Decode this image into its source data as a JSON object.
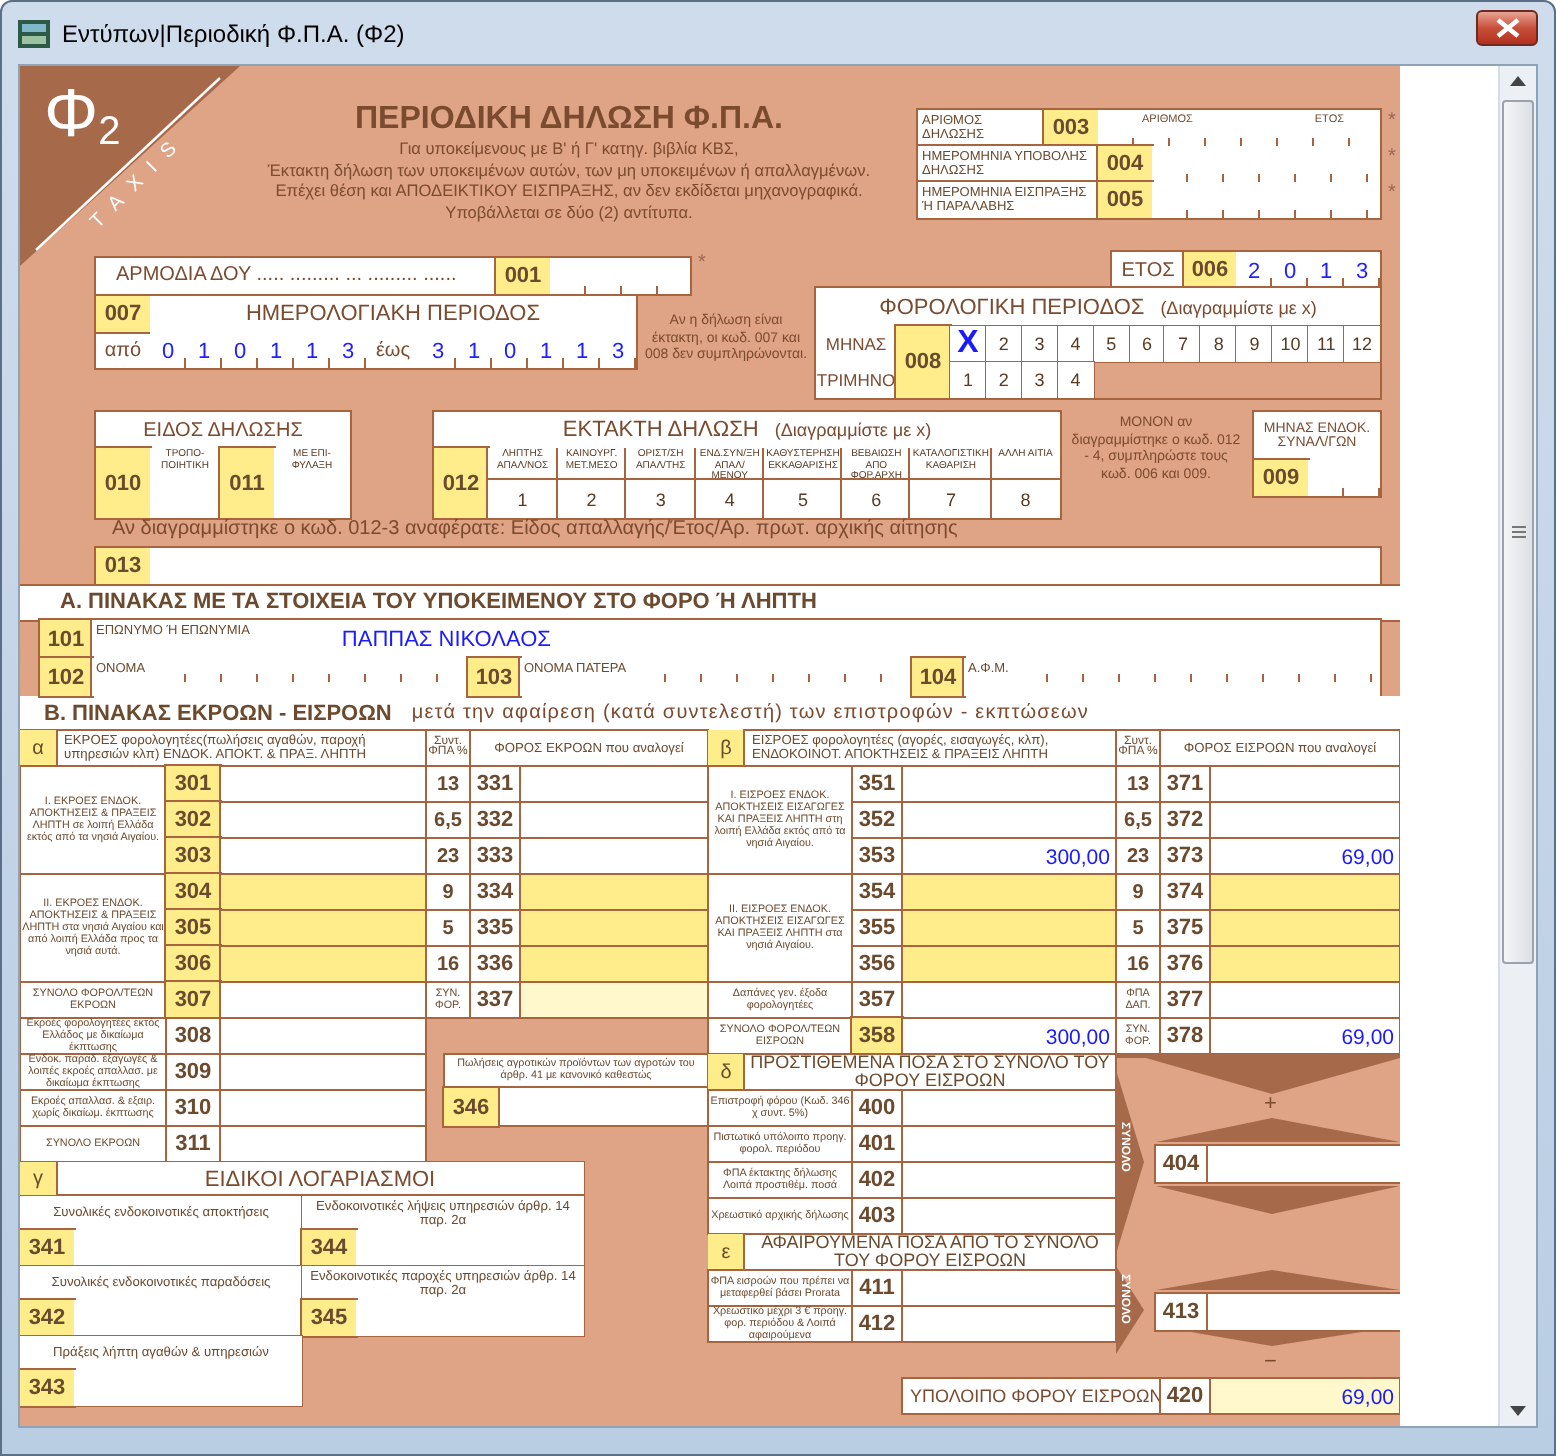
{
  "window": {
    "title": "Εντύπων|Περιοδική Φ.Π.Α. (Φ2)"
  },
  "form": {
    "logo": {
      "symbol": "Φ$_{2}$",
      "brand": "TAXIS"
    },
    "heading": {
      "title": "ΠΕΡΙΟΔΙΚΗ ΔΗΛΩΣΗ Φ.Π.Α.",
      "lines": [
        "Για υποκείμενους με Β' ή Γ' κατηγ. βιβλία ΚΒΣ,",
        "Έκτακτη δήλωση των υποκειμένων αυτών, των μη υποκειμένων ή απαλλαγμένων.",
        "Επέχει θέση και ΑΠΟΔΕΙΚΤΙΚΟΥ ΕΙΣΠΡΑΞΗΣ, αν δεν εκδίδεται μηχανογραφικά.",
        "Υποβάλλεται σε δύο (2) αντίτυπα."
      ]
    },
    "filing": [
      {
        "label": "ΑΡΙΘΜΟΣ ΔΗΛΩΣΗΣ",
        "code": "003",
        "parts": [
          "ΑΡΙΘΜΟΣ",
          "ΕΤΟΣ"
        ],
        "mark": "*"
      },
      {
        "label": "ΗΜΕΡΟΜΗΝΙΑ ΥΠΟΒΟΛΗΣ ΔΗΛΩΣΗΣ",
        "code": "004",
        "mark": "*"
      },
      {
        "label": "ΗΜΕΡΟΜΗΝΙΑ ΕΙΣΠΡΑΞΗΣ Ή ΠΑΡΑΛΑΒΗΣ",
        "code": "005",
        "mark": "*"
      }
    ],
    "office": {
      "label": "ΑΡΜΟΔΙΑ ΔΟΥ ..... ......... ... ......... ......",
      "code": "001",
      "mark": "*"
    },
    "year": {
      "label": "ΕΤΟΣ",
      "code": "006",
      "digits": [
        "2",
        "0",
        "1",
        "3"
      ]
    },
    "calendar_period": {
      "code": "007",
      "title": "ΗΜΕΡΟΛΟΓΙΑΚΗ ΠΕΡΙΟΔΟΣ",
      "from_label": "από",
      "from": [
        "0",
        "1",
        "0",
        "1",
        "1",
        "3"
      ],
      "to_label": "έως",
      "to": [
        "3",
        "1",
        "0",
        "1",
        "1",
        "3"
      ]
    },
    "period_note": "Αν η δήλωση είναι έκτακτη, οι κωδ. 007 και 008 δεν συμπληρώνονται.",
    "tax_period": {
      "title": "ΦΟΡΟΛΟΓΙΚΗ ΠΕΡΙΟΔΟΣ",
      "hint": "(Διαγραμμίστε με x)",
      "code": "008",
      "month_label": "ΜΗΝΑΣ",
      "quarter_label": "ΤΡΙΜΗΝΟ",
      "months": [
        {
          "label": "X",
          "selected": true
        },
        {
          "label": "2",
          "selected": false
        },
        {
          "label": "3",
          "selected": false
        },
        {
          "label": "4",
          "selected": false
        },
        {
          "label": "5",
          "selected": false
        },
        {
          "label": "6",
          "selected": false
        },
        {
          "label": "7",
          "selected": false
        },
        {
          "label": "8",
          "selected": false
        },
        {
          "label": "9",
          "selected": false
        },
        {
          "label": "10",
          "selected": false
        },
        {
          "label": "11",
          "selected": false
        },
        {
          "label": "12",
          "selected": false
        }
      ],
      "quarters": [
        {
          "label": "1",
          "selected": false
        },
        {
          "label": "2",
          "selected": false
        },
        {
          "label": "3",
          "selected": false
        },
        {
          "label": "4",
          "selected": false
        }
      ]
    },
    "declaration_type": {
      "title": "ΕΙΔΟΣ ΔΗΛΩΣΗΣ",
      "options": [
        {
          "code": "010",
          "label": "ΤΡΟΠΟ-ΠΟΙΗΤΙΚΗ"
        },
        {
          "code": "011",
          "label": "ΜΕ ΕΠΙ-ΦΥΛΑΞΗ"
        }
      ]
    },
    "extraordinary": {
      "title": "ΕΚΤΑΚΤΗ ΔΗΛΩΣΗ",
      "hint": "(Διαγραμμίστε με x)",
      "code": "012",
      "options": [
        {
          "label": "ΛΗΠΤΗΣ ΑΠΑΛ/ΝΟΣ",
          "number": "1"
        },
        {
          "label": "ΚΑΙΝΟΥΡΓ. ΜΕΤ.ΜΕΣΟ",
          "number": "2"
        },
        {
          "label": "ΟΡΙΣΤ/ΣΗ ΑΠΑΛ/ΤΗΣ",
          "number": "3"
        },
        {
          "label": "ΕΝΔ.ΣΥΝ/ΞΗ ΑΠΑΛ/ΜΕΝΟΥ",
          "number": "4"
        },
        {
          "label": "ΚΑΘΥΣΤΕΡΗΣΗ ΕΚΚΑΘΑΡΙΣΗΣ",
          "number": "5"
        },
        {
          "label": "ΒΕΒΑΙΩΣΗ ΑΠΟ ΦΟΡ.ΑΡΧΗ",
          "number": "6"
        },
        {
          "label": "ΚΑΤΑΛΟΓΙΣΤΙΚΗ ΚΑΘΑΡΙΣΗ",
          "number": "7"
        },
        {
          "label": "ΑΛΛΗ ΑΙΤΙΑ",
          "number": "8"
        }
      ]
    },
    "intra_note": "ΜΟΝΟΝ αν διαγραμμίστηκε ο κωδ. 012 - 4, συμπληρώστε τους κωδ. 006 και 009.",
    "intra_month": {
      "label": "ΜΗΝΑΣ ΕΝΔΟΚ. ΣΥΝΑΛ/ΓΩΝ",
      "code": "009"
    },
    "exemption": {
      "note": "Αν διαγραμμίστηκε ο κωδ. 012-3 αναφέρατε: Είδος απαλλαγής/Έτος/Αρ. πρωτ. αρχικής αίτησης",
      "code": "013"
    },
    "section_a": {
      "title": "Α. ΠΙΝΑΚΑΣ ΜΕ ΤΑ ΣΤΟΙΧΕΙΑ ΤΟΥ ΥΠΟΚΕΙΜΕΝΟΥ ΣΤΟ ΦΟΡΟ Ή ΛΗΠΤΗ",
      "fields": [
        {
          "code": "101",
          "label": "ΕΠΩΝΥΜΟ Ή ΕΠΩΝΥΜΙΑ",
          "value": "ΠΑΠΠΑΣ ΝΙΚΟΛΑΟΣ"
        },
        {
          "code": "102",
          "label": "ΟΝΟΜΑ"
        },
        {
          "code": "103",
          "label": "ΟΝΟΜΑ ΠΑΤΕΡΑ"
        },
        {
          "code": "104",
          "label": "Α.Φ.Μ."
        }
      ]
    },
    "section_b": {
      "title": "Β. ΠΙΝΑΚΑΣ ΕΚΡΟΩΝ - ΕΙΣΡΟΩΝ",
      "subtitle": "μετά την αφαίρεση (κατά συντελεστή) των επιστροφών - εκπτώσεων"
    },
    "outputs": {
      "letter": "α",
      "title": "ΕΚΡΟΕΣ φορολογητέες(πωλήσεις αγαθών, παροχή υπηρεσιών κλπ) ΕΝΔΟΚ. ΑΠΟΚΤ. & ΠΡΑΞ. ΛΗΠΤΗ",
      "rate_header": "Συντ. ΦΠΑ %",
      "tax_header": "ΦΟΡΟΣ ΕΚΡΟΩΝ που αναλογεί",
      "groups": [
        {
          "kind": "mainland",
          "label": "Ι. ΕΚΡΟΕΣ ΕΝΔΟΚ. ΑΠΟΚΤΗΣΕΙΣ & ΠΡΑΞΕΙΣ ΛΗΠΤΗ σε λοιπή Ελλάδα εκτός από τα νησιά Αιγαίου.",
          "rows": [
            {
              "code": "301",
              "rate": "13",
              "tax_code": "331"
            },
            {
              "code": "302",
              "rate": "6,5",
              "tax_code": "332"
            },
            {
              "code": "303",
              "rate": "23",
              "tax_code": "333"
            }
          ]
        },
        {
          "kind": "islands",
          "label": "ΙΙ. ΕΚΡΟΕΣ ΕΝΔΟΚ. ΑΠΟΚΤΗΣΕΙΣ & ΠΡΑΞΕΙΣ ΛΗΠΤΗ στα νησιά Αιγαίου και από λοιπή Ελλάδα προς τα νησιά αυτά.",
          "rows": [
            {
              "code": "304",
              "rate": "9",
              "tax_code": "334"
            },
            {
              "code": "305",
              "rate": "5",
              "tax_code": "335"
            },
            {
              "code": "306",
              "rate": "16",
              "tax_code": "336"
            }
          ]
        }
      ],
      "total": {
        "label": "ΣΥΝΟΛΟ ΦΟΡΟΛ/ΤΕΩΝ ΕΚΡΟΩΝ",
        "code": "307",
        "rate_label": "ΣΥΝ. ΦΟΡ.",
        "tax_code": "337"
      },
      "other": [
        {
          "label": "Εκροές φορολογητέες εκτός Ελλάδος με δικαίωμα έκπτωσης",
          "code": "308"
        },
        {
          "label": "Ενδοκ. παραδ. εξαγωγές & λοιπές εκροές απαλλασ. με δικαίωμα έκπτωσης",
          "code": "309"
        },
        {
          "label": "Εκροές απαλλασ. & εξαιρ. χωρίς δικαίωμ. έκπτωσης",
          "code": "310"
        },
        {
          "label": "ΣΥΝΟΛΟ ΕΚΡΟΩΝ",
          "code": "311"
        }
      ]
    },
    "agricultural": {
      "label": "Πωλήσεις αγροτικών προϊόντων των αγροτών του άρθρ. 41 με κανονικό καθεστώς",
      "code": "346"
    },
    "special_accounts": {
      "letter": "γ",
      "title": "ΕΙΔΙΚΟΙ ΛΟΓΑΡΙΑΣΜΟΙ",
      "items": [
        {
          "label": "Συνολικές ενδοκοινοτικές αποκτήσεις",
          "code": "341"
        },
        {
          "label": "Ενδοκοινοτικές λήψεις υπηρεσιών άρθρ. 14 παρ. 2α",
          "code": "344"
        },
        {
          "label": "Συνολικές ενδοκοινοτικές παραδόσεις",
          "code": "342"
        },
        {
          "label": "Ενδοκοινοτικές παροχές υπηρεσιών άρθρ. 14 παρ. 2α",
          "code": "345"
        },
        {
          "label": "Πράξεις λήπτη αγαθών & υπηρεσιών",
          "code": "343"
        }
      ]
    },
    "inputs": {
      "letter": "β",
      "title": "ΕΙΣΡΟΕΣ φορολογητέες (αγορές, εισαγωγές, κλπ), ΕΝΔΟΚΟΙΝΟΤ. ΑΠΟΚΤΗΣΕΙΣ & ΠΡΑΞΕΙΣ ΛΗΠΤΗ",
      "rate_header": "Συντ. ΦΠΑ %",
      "tax_header": "ΦΟΡΟΣ ΕΙΣΡΟΩΝ που αναλογεί",
      "groups": [
        {
          "kind": "mainland",
          "label": "Ι. ΕΙΣΡΟΕΣ ΕΝΔΟΚ. ΑΠΟΚΤΗΣΕΙΣ ΕΙΣΑΓΩΓΕΣ ΚΑΙ ΠΡΑΞΕΙΣ ΛΗΠΤΗ στη λοιπή Ελλάδα εκτός από τα νησιά Αιγαίου.",
          "rows": [
            {
              "code": "351",
              "rate": "13",
              "tax_code": "371"
            },
            {
              "code": "352",
              "rate": "6,5",
              "tax_code": "372"
            },
            {
              "code": "353",
              "amount": "300,00",
              "rate": "23",
              "tax_code": "373",
              "tax": "69,00"
            }
          ]
        },
        {
          "kind": "islands",
          "label": "ΙΙ. ΕΙΣΡΟΕΣ ΕΝΔΟΚ. ΑΠΟΚΤΗΣΕΙΣ ΕΙΣΑΓΩΓΕΣ ΚΑΙ ΠΡΑΞΕΙΣ ΛΗΠΤΗ στα νησιά Αιγαίου.",
          "rows": [
            {
              "code": "354",
              "rate": "9",
              "tax_code": "374"
            },
            {
              "code": "355",
              "rate": "5",
              "tax_code": "375"
            },
            {
              "code": "356",
              "rate": "16",
              "tax_code": "376"
            }
          ]
        }
      ],
      "expenses": {
        "label": "Δαπάνες γεν. έξοδα φορολογητέες",
        "code": "357",
        "rate_label": "ΦΠΑ ΔΑΠ.",
        "tax_code": "377"
      },
      "total": {
        "label": "ΣΥΝΟΛΟ ΦΟΡΟΛ/ΤΕΩΝ ΕΙΣΡΟΩΝ",
        "code": "358",
        "amount": "300,00",
        "rate_label": "ΣΥΝ. ΦΟΡ.",
        "tax_code": "378",
        "tax": "69,00"
      }
    },
    "additions": {
      "letter": "δ",
      "title": "ΠΡΟΣΤΙΘΕΜΕΝΑ ΠΟΣΑ ΣΤΟ ΣΥΝΟΛΟ ΤΟΥ ΦΟΡΟΥ ΕΙΣΡΟΩΝ",
      "rows": [
        {
          "label": "Επιστροφή φόρου (Κωδ. 346 χ συντ. 5%)",
          "code": "400"
        },
        {
          "label": "Πιστωτικό υπόλοιπο προηγ. φορολ. περιόδου",
          "code": "401"
        },
        {
          "label": "ΦΠΑ έκτακτης δήλωσης Λοιπά προστιθέμ. ποσά",
          "code": "402"
        },
        {
          "label": "Χρεωστικό αρχικής δήλωσης",
          "code": "403"
        }
      ],
      "total_label": "ΣΥΝΟΛΟ",
      "total_code": "404",
      "sign": "+"
    },
    "deductions": {
      "letter": "ε",
      "title": "ΑΦΑΙΡΟΥΜΕΝΑ ΠΟΣΑ ΑΠΟ ΤΟ ΣΥΝΟΛΟ ΤΟΥ ΦΟΡΟΥ ΕΙΣΡΟΩΝ",
      "rows": [
        {
          "label": "ΦΠΑ εισροών που πρέπει να μεταφερθεί βάσει Prorata",
          "code": "411"
        },
        {
          "label": "Χρεωστικό μέχρι 3 € προηγ. φορ. περιόδου & Λοιπά αφαιρούμενα",
          "code": "412"
        }
      ],
      "total_label": "ΣΥΝΟΛΟ",
      "total_code": "413",
      "sign": "−"
    },
    "balance": {
      "label": "ΥΠΟΛΟΙΠΟ ΦΟΡΟΥ ΕΙΣΡΟΩΝ",
      "code": "420",
      "value": "69,00"
    }
  }
}
